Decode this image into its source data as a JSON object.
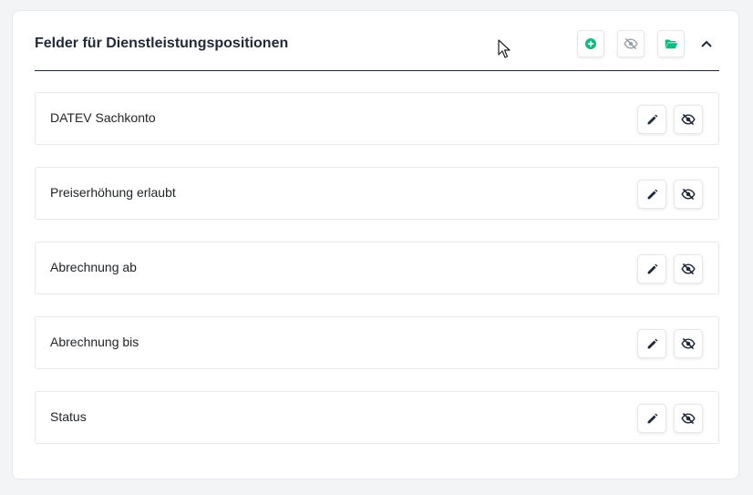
{
  "section": {
    "title": "Felder für Dienstleistungspositionen",
    "actions": [
      {
        "name": "add-field",
        "icon": "plus-circle-icon"
      },
      {
        "name": "hidden-fields",
        "icon": "eye-slash-icon"
      },
      {
        "name": "open-folder",
        "icon": "folder-open-icon"
      },
      {
        "name": "collapse",
        "icon": "chevron-up-icon"
      }
    ]
  },
  "fields": [
    {
      "label": "DATEV Sachkonto"
    },
    {
      "label": "Preiserhöhung erlaubt"
    },
    {
      "label": "Abrechnung ab"
    },
    {
      "label": "Abrechnung bis"
    },
    {
      "label": "Status"
    }
  ],
  "colors": {
    "accent": "#10b981",
    "muted_icon": "#9ca3af",
    "dark_icon": "#1f2937",
    "border": "#e5e7eb"
  }
}
